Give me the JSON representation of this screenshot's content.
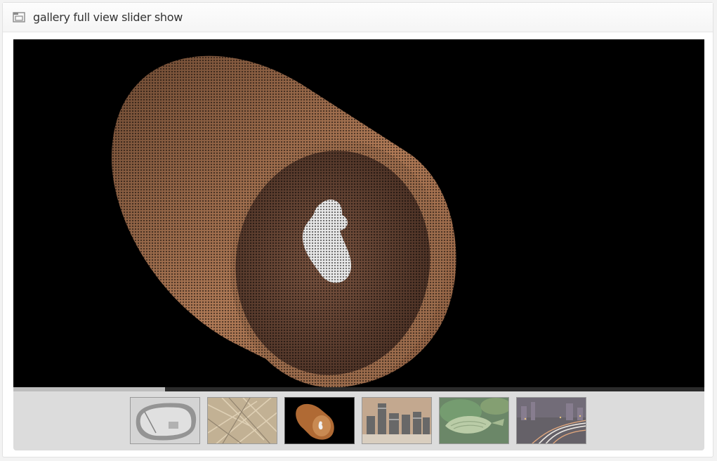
{
  "header": {
    "icon": "folder-icon",
    "title": "gallery full view slider show"
  },
  "slideshow": {
    "progress_fraction": 0.22,
    "active_index": 2,
    "thumbnails": [
      {
        "name": "side-mirror-thumbnail",
        "active": false
      },
      {
        "name": "straw-thumbnail",
        "active": false
      },
      {
        "name": "paper-cup-thumbnail",
        "active": true
      },
      {
        "name": "camera-lenses-thumbnail",
        "active": false
      },
      {
        "name": "green-bud-thumbnail",
        "active": false
      },
      {
        "name": "city-light-trails-thumbnail",
        "active": false
      }
    ]
  },
  "colors": {
    "stage_background": "#000000",
    "thumb_strip_background": "#dcdcdc",
    "progress_fill": "#bdbdbd",
    "progress_track": "#2b2b2b"
  }
}
